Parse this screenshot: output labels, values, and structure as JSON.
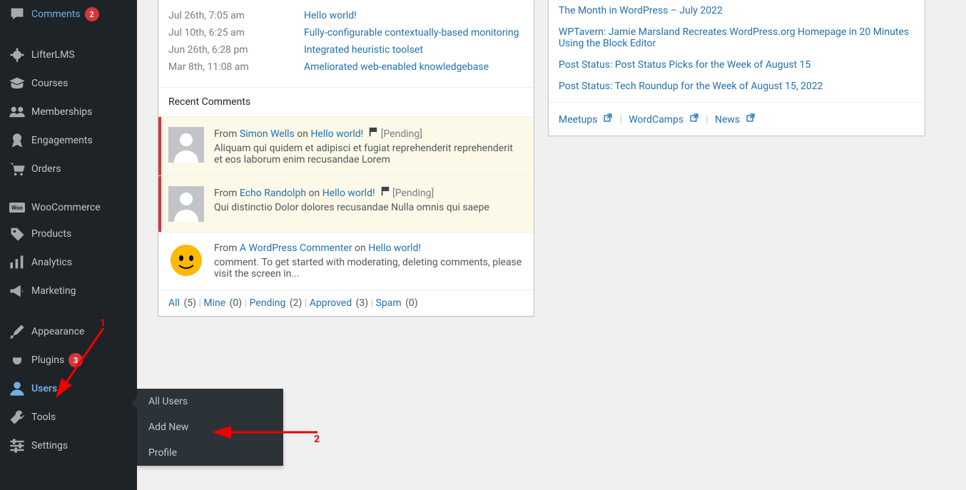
{
  "sidebar": {
    "items": [
      {
        "icon": "comment",
        "label": "Comments",
        "badge": "2"
      },
      {
        "icon": "lifter",
        "label": "LifterLMS"
      },
      {
        "icon": "cap",
        "label": "Courses"
      },
      {
        "icon": "group",
        "label": "Memberships"
      },
      {
        "icon": "award",
        "label": "Engagements"
      },
      {
        "icon": "cart",
        "label": "Orders"
      },
      {
        "icon": "woo",
        "label": "WooCommerce"
      },
      {
        "icon": "tag",
        "label": "Products"
      },
      {
        "icon": "chart",
        "label": "Analytics"
      },
      {
        "icon": "megaphone",
        "label": "Marketing"
      },
      {
        "icon": "brush",
        "label": "Appearance"
      },
      {
        "icon": "plug",
        "label": "Plugins",
        "badge": "3"
      },
      {
        "icon": "user",
        "label": "Users",
        "active": true
      },
      {
        "icon": "wrench",
        "label": "Tools"
      },
      {
        "icon": "sliders",
        "label": "Settings"
      }
    ],
    "submenu": [
      {
        "label": "All Users"
      },
      {
        "label": "Add New"
      },
      {
        "label": "Profile"
      }
    ]
  },
  "activity": {
    "rows": [
      {
        "date": "Jul 26th, 7:05 am",
        "title": "Hello world!"
      },
      {
        "date": "Jul 10th, 6:25 am",
        "title": "Fully-configurable contextually-based monitoring"
      },
      {
        "date": "Jun 26th, 6:28 pm",
        "title": "Integrated heuristic toolset"
      },
      {
        "date": "Mar 8th, 11:08 am",
        "title": "Ameliorated web-enabled knowledgebase"
      }
    ],
    "heading": "Recent Comments",
    "comments": [
      {
        "fromText": "From ",
        "author": "Simon Wells",
        "onText": " on ",
        "post": "Hello world!",
        "pending": "[Pending]",
        "body": "Aliquam qui quidem et adipisci et fugiat reprehenderit reprehenderit et eos laborum enim recusandae Lorem"
      },
      {
        "fromText": "From ",
        "author": "Echo Randolph",
        "onText": " on ",
        "post": "Hello world!",
        "pending": "[Pending]",
        "body": "Qui distinctio Dolor dolores recusandae Nulla omnis qui saepe"
      },
      {
        "fromText": "From ",
        "author": "A WordPress Commenter",
        "onText": " on ",
        "post": "Hello world!",
        "body": "comment. To get started with moderating, deleting comments, please visit the screen in..."
      }
    ],
    "filters": {
      "all": {
        "label": "All",
        "count": "(5)"
      },
      "mine": {
        "label": "Mine",
        "count": "(0)"
      },
      "pending": {
        "label": "Pending",
        "count": "(2)"
      },
      "approved": {
        "label": "Approved",
        "count": "(3)"
      },
      "spam": {
        "label": "Spam",
        "count": "(0)"
      },
      "sep": " | "
    }
  },
  "news": {
    "items": [
      "The Month in WordPress – July 2022",
      "WPTavern: Jamie Marsland Recreates WordPress.org Homepage in 20 Minutes Using the Block Editor",
      "Post Status: Post Status Picks for the Week of August 15",
      "Post Status: Tech Roundup for the Week of August 15, 2022"
    ],
    "footer": {
      "meetups": "Meetups",
      "wordcamps": "WordCamps",
      "newsLabel": "News",
      "sep": " | "
    }
  },
  "annotations": {
    "one": "1",
    "two": "2"
  }
}
